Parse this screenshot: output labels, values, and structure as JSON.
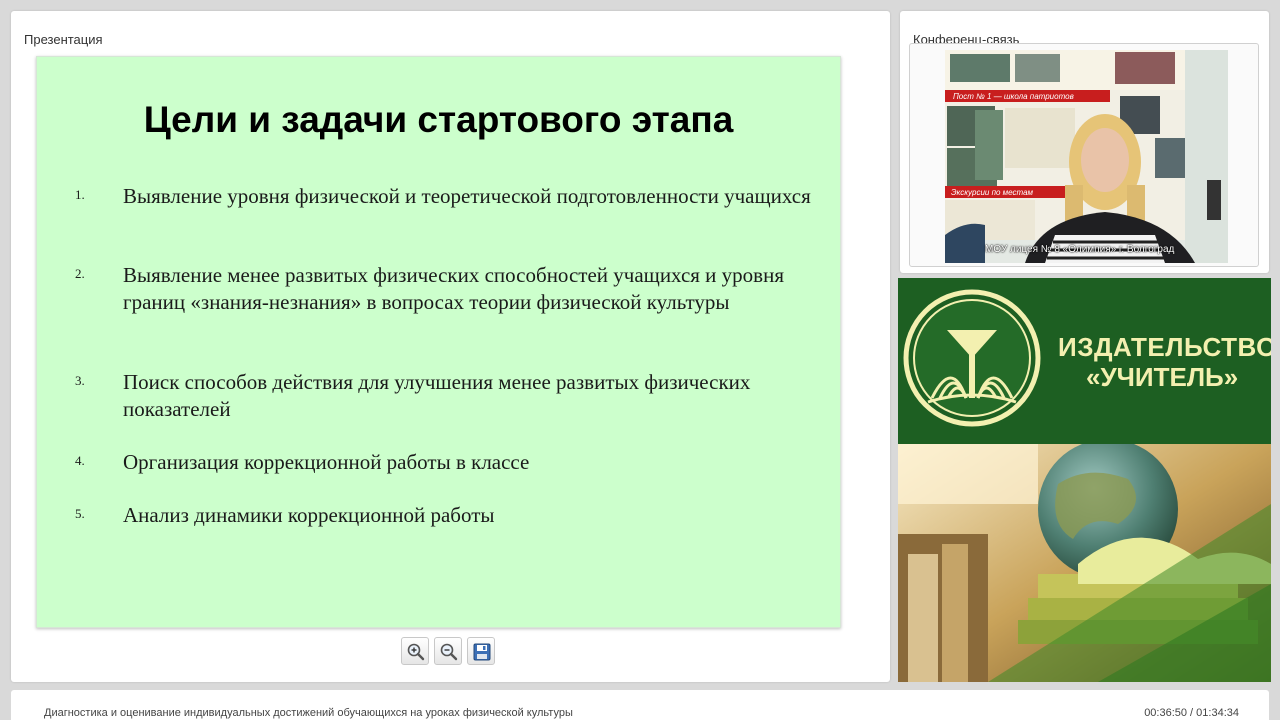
{
  "presentation": {
    "panel_title": "Презентация",
    "slide": {
      "title": "Цели и задачи стартового этапа",
      "items": [
        {
          "num": "1.",
          "text": "Выявление уровня физической и теоретической подготовленности учащихся"
        },
        {
          "num": "2.",
          "text": "Выявление менее развитых физических способностей учащихся и уровня границ «знания-незнания» в вопросах теории физической культуры"
        },
        {
          "num": "3.",
          "text": "Поиск способов действия для улучшения менее развитых физических показателей"
        },
        {
          "num": "4.",
          "text": "Организация коррекционной работы в классе"
        },
        {
          "num": "5.",
          "text": "Анализ динамики коррекционной работы"
        }
      ]
    },
    "toolbar": {
      "zoom_in_icon": "zoom-in-icon",
      "zoom_out_icon": "zoom-out-icon",
      "save_icon": "save-icon"
    }
  },
  "conference": {
    "panel_title": "Конференц-связь",
    "video_caption": "МОУ лицея № 8 «Олимпия» г. Волгоград",
    "poster_banner_1": "Пост № 1 — школа патриотов",
    "poster_banner_2": "Экскурсии по местам"
  },
  "publisher": {
    "name_line1": "ИЗДАТЕЛЬСТВО",
    "name_line2": "«УЧИТЕЛЬ»"
  },
  "footer": {
    "title": "Диагностика и оценивание индивидуальных достижений обучающихся на уроках физической культуры",
    "time": "00:36:50 / 01:34:34"
  },
  "colors": {
    "slide_background": "#ccffcc",
    "publisher_green": "#1d5f22",
    "publisher_text": "#f3f0b0"
  }
}
